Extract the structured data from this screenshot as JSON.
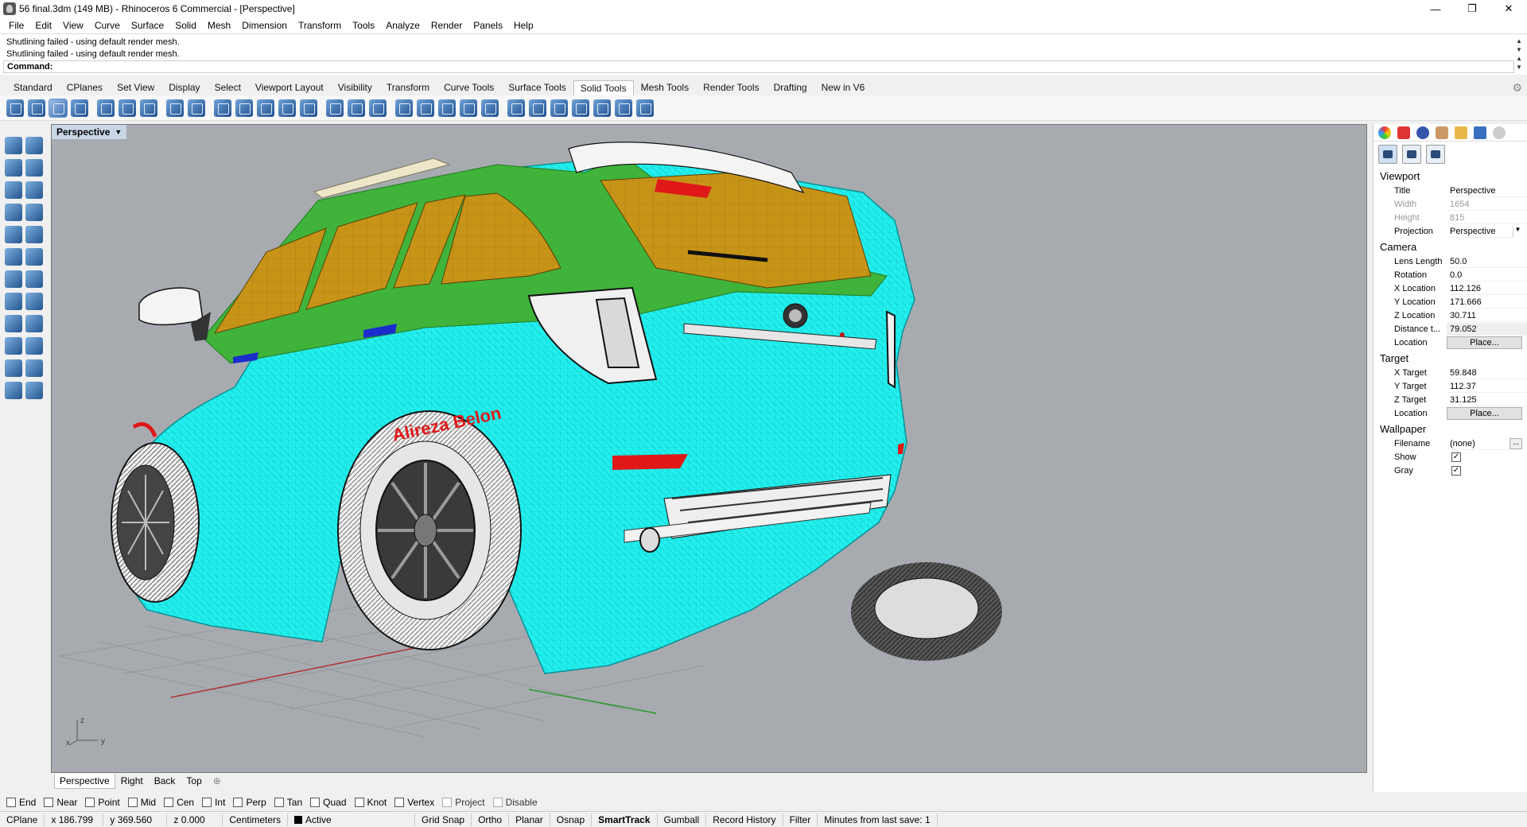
{
  "window": {
    "title": "56 final.3dm (149 MB) - Rhinoceros 6 Commercial - [Perspective]",
    "minimize": "—",
    "restore": "❐",
    "close": "✕"
  },
  "menus": [
    "File",
    "Edit",
    "View",
    "Curve",
    "Surface",
    "Solid",
    "Mesh",
    "Dimension",
    "Transform",
    "Tools",
    "Analyze",
    "Render",
    "Panels",
    "Help"
  ],
  "command": {
    "history": [
      "Shutlining failed - using default render mesh.",
      "Shutlining failed - using default render mesh."
    ],
    "prompt": "Command:"
  },
  "toolbar_tabs": [
    "Standard",
    "CPlanes",
    "Set View",
    "Display",
    "Select",
    "Viewport Layout",
    "Visibility",
    "Transform",
    "Curve Tools",
    "Surface Tools",
    "Solid Tools",
    "Mesh Tools",
    "Render Tools",
    "Drafting",
    "New in V6"
  ],
  "active_toolbar_tab": "Solid Tools",
  "toolbar_icons": [
    "boolean-union-icon",
    "boolean-difference-icon",
    "boolean-intersection-icon",
    "boolean-split-icon",
    "cap-icon",
    "extract-surface-icon",
    "shell-icon",
    "fillet-edge-icon",
    "chamfer-edge-icon",
    "blend-edge-icon",
    "offset-surface-icon",
    "extrude-face-icon",
    "move-face-icon",
    "move-edge-icon",
    "split-face-icon",
    "fold-face-icon",
    "wire-cut-icon",
    "make-hole-icon",
    "round-hole-icon",
    "place-hole-icon",
    "array-hole-icon",
    "rotate-hole-icon",
    "move-hole-icon",
    "text-icon",
    "merge-faces-icon",
    "select-solids-icon",
    "create-solid-icon",
    "solid-properties-icon",
    "mesh-boolean-icon"
  ],
  "viewport": {
    "label": "Perspective",
    "axes_labels": {
      "x": "x",
      "y": "y",
      "z": "z"
    },
    "decal_text": "Alireza Belon"
  },
  "view_tabs": [
    "Perspective",
    "Right",
    "Back",
    "Top"
  ],
  "active_view_tab": "Perspective",
  "osnaps": [
    {
      "label": "End",
      "checked": false
    },
    {
      "label": "Near",
      "checked": false
    },
    {
      "label": "Point",
      "checked": false
    },
    {
      "label": "Mid",
      "checked": false
    },
    {
      "label": "Cen",
      "checked": false
    },
    {
      "label": "Int",
      "checked": false
    },
    {
      "label": "Perp",
      "checked": false
    },
    {
      "label": "Tan",
      "checked": false
    },
    {
      "label": "Quad",
      "checked": false
    },
    {
      "label": "Knot",
      "checked": false
    },
    {
      "label": "Vertex",
      "checked": false
    },
    {
      "label": "Project",
      "checked": false
    },
    {
      "label": "Disable",
      "checked": false
    }
  ],
  "status": {
    "cplane": "CPlane",
    "x": "x 186.799",
    "y": "y 369.560",
    "z": "z 0.000",
    "units": "Centimeters",
    "layer": "Active",
    "grid_snap": "Grid Snap",
    "ortho": "Ortho",
    "planar": "Planar",
    "osnap": "Osnap",
    "smarttrack": "SmartTrack",
    "gumball": "Gumball",
    "record_history": "Record History",
    "filter": "Filter",
    "last_save": "Minutes from last save: 1"
  },
  "properties": {
    "viewport_section": "Viewport",
    "title_label": "Title",
    "title_value": "Perspective",
    "width_label": "Width",
    "width_value": "1654",
    "height_label": "Height",
    "height_value": "815",
    "projection_label": "Projection",
    "projection_value": "Perspective",
    "camera_section": "Camera",
    "lens_label": "Lens Length",
    "lens_value": "50.0",
    "rotation_label": "Rotation",
    "rotation_value": "0.0",
    "xloc_label": "X Location",
    "xloc_value": "112.126",
    "yloc_label": "Y Location",
    "yloc_value": "171.666",
    "zloc_label": "Z Location",
    "zloc_value": "30.711",
    "dist_label": "Distance t...",
    "dist_value": "79.052",
    "cam_location_label": "Location",
    "cam_place_button": "Place...",
    "target_section": "Target",
    "xt_label": "X Target",
    "xt_value": "59.848",
    "yt_label": "Y Target",
    "yt_value": "112.37",
    "zt_label": "Z Target",
    "zt_value": "31.125",
    "tgt_location_label": "Location",
    "tgt_place_button": "Place...",
    "wallpaper_section": "Wallpaper",
    "filename_label": "Filename",
    "filename_value": "(none)",
    "filename_browse": "...",
    "show_label": "Show",
    "show_checked": true,
    "gray_label": "Gray",
    "gray_checked": true
  },
  "colors": {
    "body": "#22f0ee",
    "glass": "#c79418",
    "trim_green": "#3fb33a",
    "taillight": "#e01818",
    "viewport_bg": "#a7abb0"
  }
}
